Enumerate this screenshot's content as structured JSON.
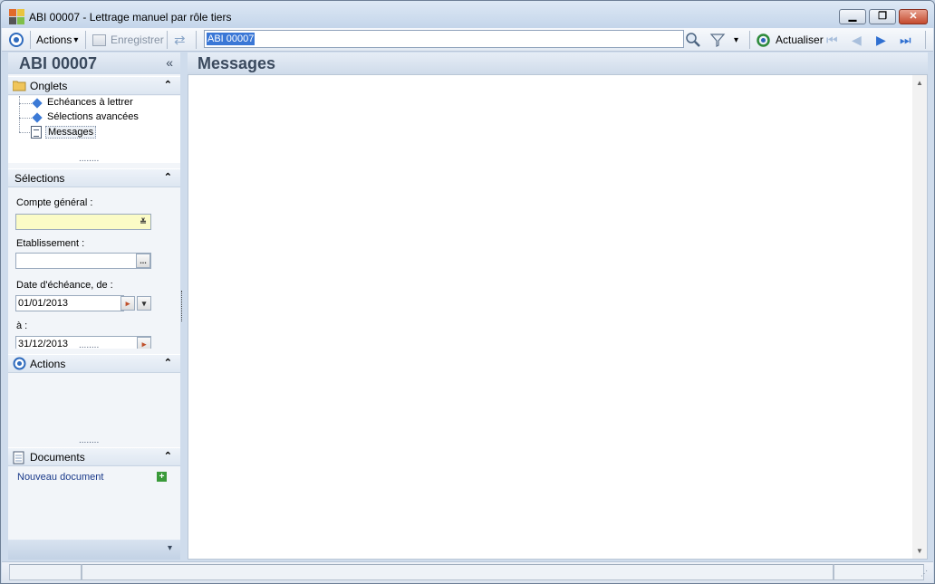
{
  "window": {
    "title": "ABI 00007 -  Lettrage manuel par rôle tiers",
    "minimize_glyph": "▁",
    "restore_glyph": "❐",
    "close_glyph": "✕"
  },
  "toolbar": {
    "actions_label": "Actions",
    "actions_caret": "▾",
    "save_label": "Enregistrer",
    "search_value": "ABI 00007",
    "filter_caret": "▾",
    "refresh_label": "Actualiser",
    "first_glyph": "⏮",
    "prev_glyph": "◀",
    "next_glyph": "▶",
    "last_glyph": "⏭"
  },
  "left": {
    "header_title": "ABI 00007",
    "collapse_glyph": "«",
    "onglets": {
      "title": "Onglets",
      "chevron": "⌃",
      "items": [
        {
          "label": "Echéances à lettrer"
        },
        {
          "label": "Sélections avancées"
        },
        {
          "label": "Messages"
        }
      ]
    },
    "selections": {
      "title": "Sélections",
      "chevron": "⌃",
      "compte_label": "Compte général :",
      "compte_value": "",
      "compte_btn": "≚",
      "etab_label": "Etablissement :",
      "etab_value": "",
      "etab_btn": "...",
      "date_from_label": "Date d'échéance, de :",
      "date_from_value": "01/01/2013",
      "date_to_label": "à :",
      "date_to_value": "31/12/2013",
      "date_btn_glyph": "▸",
      "dropdown_glyph": "▾"
    },
    "actions": {
      "title": "Actions",
      "chevron": "⌃"
    },
    "documents": {
      "title": "Documents",
      "chevron": "⌃",
      "new_doc_label": "Nouveau document",
      "add_glyph": "+"
    },
    "bottom_caret": "▾",
    "grip": "........"
  },
  "main": {
    "title": "Messages",
    "scroll_up": "▲",
    "scroll_down": "▼"
  }
}
